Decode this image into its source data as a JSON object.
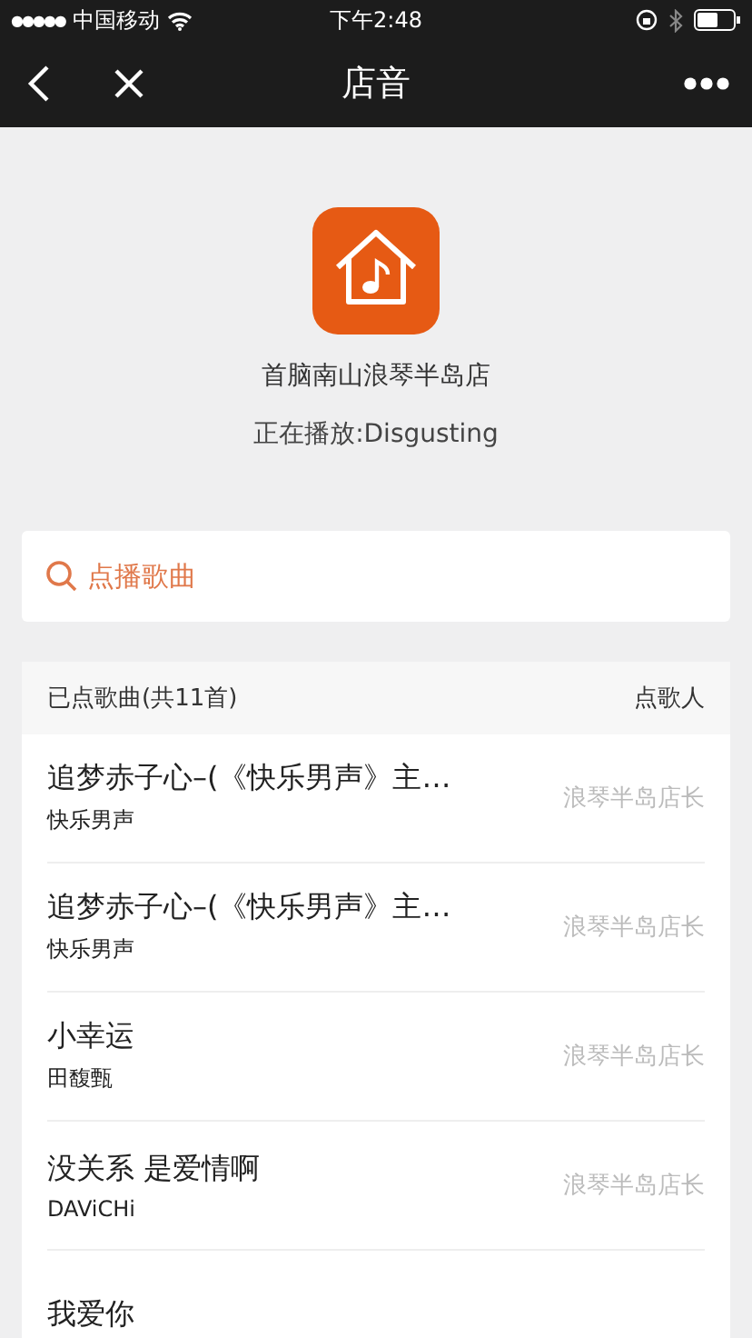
{
  "status_bar": {
    "signal_dots": "●●●●●",
    "carrier": "中国移动",
    "time": "下午2:48"
  },
  "nav": {
    "title": "店音"
  },
  "store": {
    "name": "首脑南山浪琴半岛店",
    "now_playing": "正在播放:Disgusting"
  },
  "search": {
    "placeholder": "点播歌曲"
  },
  "playlist": {
    "heading": "已点歌曲(共11首)",
    "requester_heading": "点歌人",
    "rows": [
      {
        "title": "追梦赤子心–(《快乐男声》主…",
        "artist": "快乐男声",
        "requester": "浪琴半岛店长"
      },
      {
        "title": "追梦赤子心–(《快乐男声》主…",
        "artist": "快乐男声",
        "requester": "浪琴半岛店长"
      },
      {
        "title": "小幸运",
        "artist": "田馥甄",
        "requester": "浪琴半岛店长"
      },
      {
        "title": "没关系 是爱情啊",
        "artist": "DAViCHi",
        "requester": "浪琴半岛店长"
      },
      {
        "title": "我爱你"
      }
    ]
  }
}
